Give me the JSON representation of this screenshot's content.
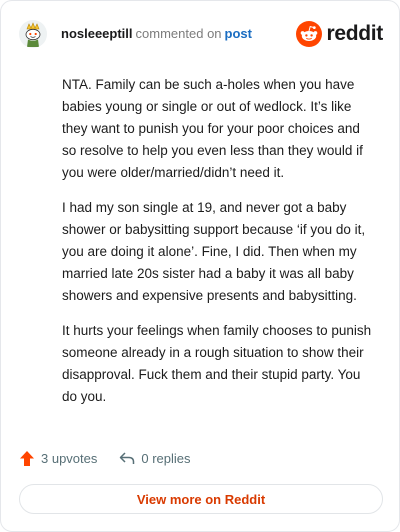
{
  "header": {
    "username": "nosleeeptill",
    "action": "commented on",
    "link": "post",
    "brand": "reddit"
  },
  "comment": {
    "paragraphs": [
      "NTA. Family can be such a-holes when you have babies young or single or out of wedlock. It’s like they want to punish you for your poor choices and so resolve to help you even less than they would if you were older/married/didn’t need it.",
      "I had my son single at 19, and never got a baby shower or babysitting support because ‘if you do it, you are doing it alone’. Fine, I did. Then when my married late 20s sister had a baby it was all baby showers and expensive presents and babysitting.",
      "It hurts your feelings when family chooses to punish someone already in a rough situation to show their disapproval. Fuck them and their stupid party. You do you."
    ]
  },
  "actions": {
    "upvotes": "3 upvotes",
    "replies": "0 replies"
  },
  "footer": {
    "view_more": "View more on Reddit"
  },
  "colors": {
    "brand_orange": "#ff4500",
    "link_blue": "#1a6dc2",
    "view_more_text": "#d93a00"
  },
  "icons": {
    "avatar": "avatar",
    "brand": "reddit-snoo-icon",
    "upvote": "upvote-arrow-icon",
    "reply": "reply-arrow-icon"
  }
}
